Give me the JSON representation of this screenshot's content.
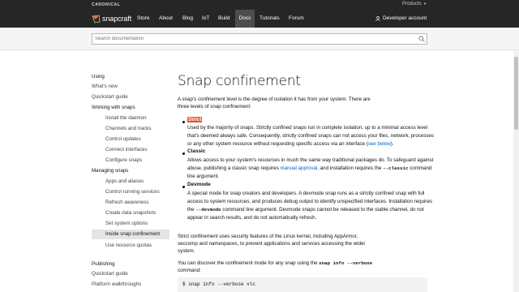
{
  "topbar": {
    "brand": "CANONICAL",
    "products_label": "Products"
  },
  "nav": {
    "logo_text": "snapcraft",
    "items": [
      {
        "label": "Store"
      },
      {
        "label": "About"
      },
      {
        "label": "Blog"
      },
      {
        "label": "IoT"
      },
      {
        "label": "Build"
      },
      {
        "label": "Docs",
        "active": true
      },
      {
        "label": "Tutorials"
      },
      {
        "label": "Forum"
      }
    ],
    "account_label": "Developer account"
  },
  "search": {
    "placeholder": "Search documentation"
  },
  "sidebar": {
    "items": [
      {
        "label": "Using",
        "kind": "head"
      },
      {
        "label": "What's new",
        "kind": "link"
      },
      {
        "label": "Quickstart guide",
        "kind": "link"
      },
      {
        "label": "Working with snaps",
        "kind": "head"
      },
      {
        "label": "Install the daemon",
        "kind": "sub"
      },
      {
        "label": "Channels and tracks",
        "kind": "sub"
      },
      {
        "label": "Control updates",
        "kind": "sub"
      },
      {
        "label": "Connect interfaces",
        "kind": "sub"
      },
      {
        "label": "Configure snaps",
        "kind": "sub"
      },
      {
        "label": "Managing snaps",
        "kind": "head"
      },
      {
        "label": "Apps and aliases",
        "kind": "sub"
      },
      {
        "label": "Control running services",
        "kind": "sub"
      },
      {
        "label": "Refresh awareness",
        "kind": "sub"
      },
      {
        "label": "Create data snapshots",
        "kind": "sub"
      },
      {
        "label": "Set system options",
        "kind": "sub"
      },
      {
        "label": "Inside snap confinement",
        "kind": "sub",
        "active": true
      },
      {
        "label": "Use resource quotas",
        "kind": "sub"
      },
      {
        "label": "Publishing",
        "kind": "head"
      },
      {
        "label": "Quickstart guide",
        "kind": "link"
      },
      {
        "label": "Platform walkthroughs",
        "kind": "link"
      }
    ]
  },
  "content": {
    "title": "Snap confinement",
    "intro_1": "A snap's confinement level is the degree of isolation it has from your system. There are",
    "intro_2": "three levels of snap confinement:",
    "strict": {
      "term": "Strict",
      "l1": "Used by the majority of snaps. Strictly confined snaps run in complete isolation, up to a minimal access level",
      "l2": "that's deemed always safe. Consequently, strictly confined snaps can not access your files, network, processes",
      "l3a": "or any other system resource without requesting specific access via an interface (",
      "l3link": "see below",
      "l3b": ")."
    },
    "classic": {
      "term": "Classic",
      "l1": "Allows access to your system's resources in much the same way traditional packages do. To safeguard against",
      "l2a": "abuse, publishing a classic snap requires ",
      "l2link": "manual approval",
      "l2b": ", and installation requires the ",
      "l2code": "--classic",
      "l2c": " command",
      "l3": "line argument."
    },
    "devmode": {
      "term": "Devmode",
      "l1": "A special mode for snap creators and developers. A devmode snap runs as a strictly confined snap with full",
      "l2": "access to system resources, and produces debug output to identify unspecified interfaces. Installation requires",
      "l3a": "the ",
      "l3code": "--devmode",
      "l3b": " command line argument. Devmode snaps cannot be released to the stable channel, do not",
      "l4": "appear in search results, and do not automatically refresh."
    },
    "para2_1": "Strict confinement uses security features of the Linux kernel, including AppArmor,",
    "para2_2": "seccomp and namespaces, to prevent applications and services accessing the wider",
    "para2_3": "system.",
    "para3a": "You can discover the confinement mode for any snap using the ",
    "para3code": "snap info --verbose",
    "para3b": "command:",
    "code_line": "$ snap info --verbose vlc"
  },
  "colors": {
    "nav_bg": "#262626",
    "accent": "#e95420",
    "link": "#0066cc"
  }
}
